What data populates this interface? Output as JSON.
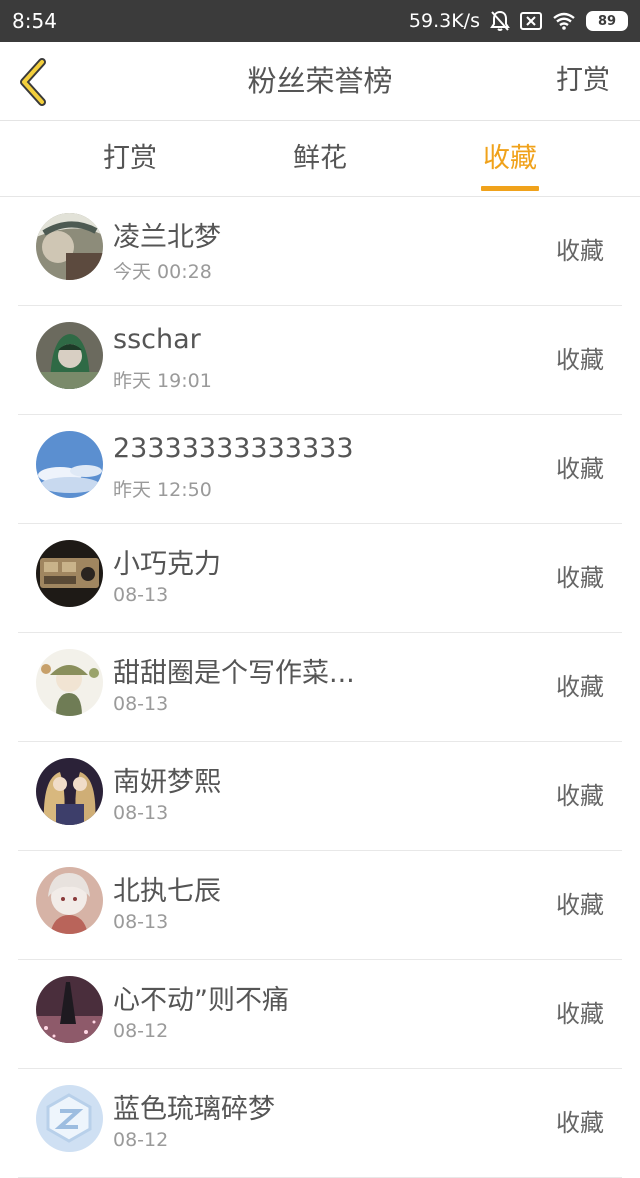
{
  "status_bar": {
    "time": "8:54",
    "network_speed": "59.3K/s",
    "battery": "89"
  },
  "header": {
    "title": "粉丝荣誉榜",
    "action_label": "打赏"
  },
  "tabs": [
    {
      "label": "打赏",
      "active": false
    },
    {
      "label": "鲜花",
      "active": false
    },
    {
      "label": "收藏",
      "active": true
    }
  ],
  "colors": {
    "accent": "#f0a21b",
    "status_bar_bg": "#3b3b3b"
  },
  "list": [
    {
      "name": "凌兰北梦",
      "time": "今天 00:28",
      "action": "收藏"
    },
    {
      "name": "sschar",
      "time": "昨天 19:01",
      "action": "收藏"
    },
    {
      "name": "23333333333333",
      "time": "昨天 12:50",
      "action": "收藏"
    },
    {
      "name": "小巧克力",
      "time": "08-13",
      "action": "收藏"
    },
    {
      "name": "甜甜圈是个写作菜...",
      "time": "08-13",
      "action": "收藏"
    },
    {
      "name": "南妍梦熙",
      "time": "08-13",
      "action": "收藏"
    },
    {
      "name": "北执七辰",
      "time": "08-13",
      "action": "收藏"
    },
    {
      "name": "心不动”则不痛",
      "time": "08-12",
      "action": "收藏"
    },
    {
      "name": "蓝色琉璃碎梦",
      "time": "08-12",
      "action": "收藏"
    }
  ]
}
